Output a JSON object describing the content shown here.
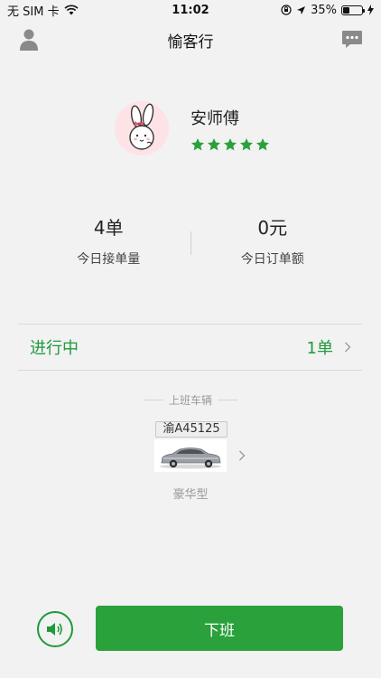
{
  "status_bar": {
    "carrier": "无 SIM 卡",
    "time": "11:02",
    "battery_percent": "35%",
    "battery_level": 0.35
  },
  "nav": {
    "title": "愉客行",
    "left_icon": "user-icon",
    "right_icon": "message-icon"
  },
  "profile": {
    "name": "安师傅",
    "rating": 5,
    "avatar_icon": "rabbit-avatar"
  },
  "stats": [
    {
      "value": "4单",
      "label": "今日接单量"
    },
    {
      "value": "0元",
      "label": "今日订单额"
    }
  ],
  "in_progress": {
    "label": "进行中",
    "count": "1单"
  },
  "vehicle": {
    "header": "上班车辆",
    "plate": "渝A45125",
    "type": "豪华型"
  },
  "actions": {
    "voice_icon": "speaker-icon",
    "off_work_label": "下班"
  },
  "colors": {
    "primary_green": "#2aa13b",
    "background": "#f2f2f2",
    "avatar_bg": "#fde3e5"
  }
}
